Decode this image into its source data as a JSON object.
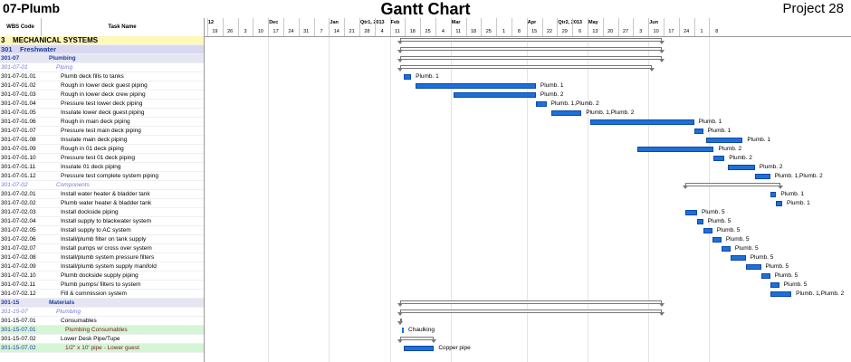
{
  "header": {
    "sheet_name": "07-Plumb",
    "title": "Gantt Chart",
    "project": "Project 28"
  },
  "columns": {
    "wbs": "WBS Code",
    "task": "Task Name"
  },
  "timeline": {
    "months": [
      {
        "label": "12",
        "week": 0
      },
      {
        "label": "Dec",
        "week": 4
      },
      {
        "label": "Qtr1, 2013",
        "week": 10
      },
      {
        "label": "Jan",
        "week": 8
      },
      {
        "label": "Feb",
        "week": 12
      },
      {
        "label": "Mar",
        "week": 16
      },
      {
        "label": "Qtr2, 2013",
        "week": 23
      },
      {
        "label": "Apr",
        "week": 21
      },
      {
        "label": "May",
        "week": 25
      },
      {
        "label": "Jun",
        "week": 29
      }
    ],
    "weeks": [
      "19",
      "26",
      "3",
      "10",
      "17",
      "24",
      "31",
      "7",
      "14",
      "21",
      "28",
      "4",
      "11",
      "18",
      "25",
      "4",
      "11",
      "18",
      "25",
      "1",
      "8",
      "15",
      "22",
      "29",
      "6",
      "13",
      "20",
      "27",
      "3",
      "10",
      "17",
      "24",
      "1",
      "8"
    ]
  },
  "rows": [
    {
      "wbs": "3",
      "task": "MECHANICAL SYSTEMS",
      "level": "section"
    },
    {
      "wbs": "301",
      "task": "Freshwater",
      "level": "sub1"
    },
    {
      "wbs": "301-07",
      "task": "Plumbing",
      "level": "sub2"
    },
    {
      "wbs": "301-07-01",
      "task": "Piping",
      "level": "sub3"
    },
    {
      "wbs": "301-07-01.01",
      "task": "Plumb deck fills to tanks",
      "level": "task"
    },
    {
      "wbs": "301-07-01.02",
      "task": "Rough in lower deck guest piping",
      "level": "task"
    },
    {
      "wbs": "301-07-01.03",
      "task": "Rough in lower deck crew piping",
      "level": "task"
    },
    {
      "wbs": "301-07-01.04",
      "task": "Pressure test lower deck piping",
      "level": "task"
    },
    {
      "wbs": "301-07-01.05",
      "task": "Insulate lower deck guest piping",
      "level": "task"
    },
    {
      "wbs": "301-07-01.06",
      "task": "Rough in main deck piping",
      "level": "task"
    },
    {
      "wbs": "301-07-01.07",
      "task": "Pressure test main deck piping",
      "level": "task"
    },
    {
      "wbs": "301-07-01.08",
      "task": "Insulate main deck piping",
      "level": "task"
    },
    {
      "wbs": "301-07-01.09",
      "task": "Rough in 01 deck piping",
      "level": "task"
    },
    {
      "wbs": "301-07-01.10",
      "task": "Pressure test 01 deck piping",
      "level": "task"
    },
    {
      "wbs": "301-07-01.11",
      "task": "Insulate 01 deck piping",
      "level": "task"
    },
    {
      "wbs": "301-07-01.12",
      "task": "Pressure test complete system piping",
      "level": "task"
    },
    {
      "wbs": "301-07-02",
      "task": "Components",
      "level": "sub3"
    },
    {
      "wbs": "301-07-02.01",
      "task": "Install water heater & bladder tank",
      "level": "task"
    },
    {
      "wbs": "301-07-02.02",
      "task": "Plumb water heater & bladder tank",
      "level": "task"
    },
    {
      "wbs": "301-07-02.03",
      "task": "Install dockside piping",
      "level": "task"
    },
    {
      "wbs": "301-07-02.04",
      "task": "Install supply to blackwater system",
      "level": "task"
    },
    {
      "wbs": "301-07-02.05",
      "task": "Install supply to AC system",
      "level": "task"
    },
    {
      "wbs": "301-07-02.06",
      "task": "Install/plumb filter on tank supply",
      "level": "task"
    },
    {
      "wbs": "301-07-02.07",
      "task": "Install pumps w/ cross over system",
      "level": "task"
    },
    {
      "wbs": "301-07-02.08",
      "task": "Install/plumb system pressure filters",
      "level": "task"
    },
    {
      "wbs": "301-07-02.09",
      "task": "Install/plumb system supply manifold",
      "level": "task"
    },
    {
      "wbs": "301-07-02.10",
      "task": "Plumb dockside supply piping",
      "level": "task"
    },
    {
      "wbs": "301-07-02.11",
      "task": "Plumb pumps/ filters to system",
      "level": "task"
    },
    {
      "wbs": "301-07-02.12",
      "task": "Fill & commission system",
      "level": "task"
    },
    {
      "wbs": "301-15",
      "task": "Materials",
      "level": "sub2"
    },
    {
      "wbs": "301-15-07",
      "task": "Plumbing",
      "level": "sub3"
    },
    {
      "wbs": "301-15-07.01",
      "task": "Consumables",
      "level": "mid"
    },
    {
      "wbs": "301-15-07.01",
      "task": "Plumbing Consumables",
      "level": "green"
    },
    {
      "wbs": "301-15-07.02",
      "task": "Lower Desk Pipe/Tupe",
      "level": "mid"
    },
    {
      "wbs": "301-15-07.02",
      "task": "1/2\" x 10' pipe  - Lower guest",
      "level": "green"
    }
  ],
  "gantt": [
    {
      "row": 0,
      "kind": "summary",
      "start": 12.7,
      "end": 29.9
    },
    {
      "row": 1,
      "kind": "summary",
      "start": 12.7,
      "end": 29.9
    },
    {
      "row": 2,
      "kind": "summary",
      "start": 12.7,
      "end": 29.9
    },
    {
      "row": 3,
      "kind": "summary",
      "start": 12.7,
      "end": 29.2
    },
    {
      "row": 4,
      "kind": "bar",
      "start": 12.9,
      "end": 13.4,
      "label": "Plumb. 1"
    },
    {
      "row": 5,
      "kind": "bar",
      "start": 13.7,
      "end": 21.6,
      "label": "Plumb. 1"
    },
    {
      "row": 6,
      "kind": "bar",
      "start": 16.2,
      "end": 21.6,
      "label": "Plumb. 2"
    },
    {
      "row": 7,
      "kind": "bar",
      "start": 21.6,
      "end": 22.3,
      "label": "Plumb. 1,Plumb. 2"
    },
    {
      "row": 8,
      "kind": "bar",
      "start": 22.6,
      "end": 24.6,
      "label": "Plumb. 1,Plumb. 2"
    },
    {
      "row": 9,
      "kind": "bar",
      "start": 25.2,
      "end": 32.0,
      "label": "Plumb. 1"
    },
    {
      "row": 10,
      "kind": "bar",
      "start": 32.0,
      "end": 32.6,
      "label": "Plumb. 1"
    },
    {
      "row": 11,
      "kind": "bar",
      "start": 32.8,
      "end": 35.2,
      "label": "Plumb. 1"
    },
    {
      "row": 12,
      "kind": "bar",
      "start": 28.3,
      "end": 33.3,
      "label": "Plumb. 2"
    },
    {
      "row": 13,
      "kind": "bar",
      "start": 33.3,
      "end": 34.0,
      "label": "Plumb. 2"
    },
    {
      "row": 14,
      "kind": "bar",
      "start": 34.2,
      "end": 36.0,
      "label": "Plumb. 2"
    },
    {
      "row": 15,
      "kind": "bar",
      "start": 36.0,
      "end": 37.0,
      "label": "Plumb. 1,Plumb. 2"
    },
    {
      "row": 16,
      "kind": "summary",
      "start": 31.4,
      "end": 37.7
    },
    {
      "row": 17,
      "kind": "bar",
      "start": 37.0,
      "end": 37.4,
      "label": "Plumb. 1"
    },
    {
      "row": 18,
      "kind": "bar",
      "start": 37.4,
      "end": 37.8,
      "label": "Plumb. 1"
    },
    {
      "row": 19,
      "kind": "bar",
      "start": 31.4,
      "end": 32.2,
      "label": "Plumb. 5"
    },
    {
      "row": 20,
      "kind": "bar",
      "start": 32.2,
      "end": 32.6,
      "label": "Plumb. 5"
    },
    {
      "row": 21,
      "kind": "bar",
      "start": 32.6,
      "end": 33.2,
      "label": "Plumb. 5"
    },
    {
      "row": 22,
      "kind": "bar",
      "start": 33.2,
      "end": 33.8,
      "label": "Plumb. 5"
    },
    {
      "row": 23,
      "kind": "bar",
      "start": 33.8,
      "end": 34.4,
      "label": "Plumb. 5"
    },
    {
      "row": 24,
      "kind": "bar",
      "start": 34.4,
      "end": 35.4,
      "label": "Plumb. 5"
    },
    {
      "row": 25,
      "kind": "bar",
      "start": 35.4,
      "end": 36.4,
      "label": "Plumb. 5"
    },
    {
      "row": 26,
      "kind": "bar",
      "start": 36.4,
      "end": 37.0,
      "label": "Plumb. 5"
    },
    {
      "row": 27,
      "kind": "bar",
      "start": 37.0,
      "end": 37.6,
      "label": "Plumb. 5"
    },
    {
      "row": 28,
      "kind": "bar",
      "start": 37.0,
      "end": 38.4,
      "label": "Plumb. 1,Plumb. 2"
    },
    {
      "row": 29,
      "kind": "summary",
      "start": 12.7,
      "end": 29.9
    },
    {
      "row": 30,
      "kind": "summary",
      "start": 12.7,
      "end": 29.9
    },
    {
      "row": 31,
      "kind": "summary",
      "start": 12.7,
      "end": 12.7
    },
    {
      "row": 32,
      "kind": "marker",
      "start": 12.8,
      "end": 12.9,
      "label": "Chaulking"
    },
    {
      "row": 33,
      "kind": "summary",
      "start": 12.7,
      "end": 14.9
    },
    {
      "row": 34,
      "kind": "bar",
      "start": 12.9,
      "end": 14.9,
      "label": "Copper pipe"
    }
  ],
  "colors": {
    "bar": "#1f6fd8",
    "section_bg": "#fff9b8",
    "sub_bg": "#d8d8f0",
    "green_bg": "#d6f4d6"
  }
}
